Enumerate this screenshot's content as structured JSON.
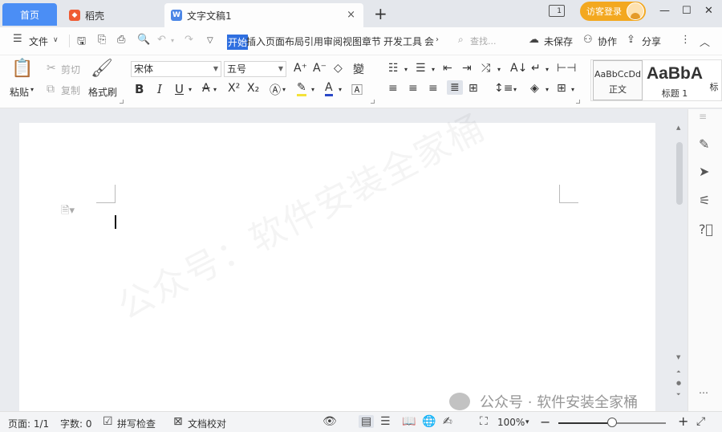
{
  "tabs": {
    "home": "首页",
    "daoke": "稻壳",
    "doc": "文字文稿1",
    "close_glyph": "×",
    "add_glyph": "+"
  },
  "window": {
    "badge": "1",
    "guest_login": "访客登录"
  },
  "menu": {
    "file": "文件",
    "tabs": [
      "开始",
      "插入",
      "页面",
      "布局",
      "引用",
      "审阅",
      "视图",
      "章节",
      "开发工具",
      "会"
    ],
    "search_placeholder": "查找...",
    "unsaved": "未保存",
    "collab": "协作",
    "share": "分享"
  },
  "ribbon": {
    "paste": "粘贴",
    "cut": "剪切",
    "copy": "复制",
    "format_painter": "格式刷",
    "font_name": "宋体",
    "font_size": "五号",
    "styles": [
      {
        "preview": "AaBbCcDd",
        "label": "正文"
      },
      {
        "preview": "AaBbA",
        "label": "标题 1"
      }
    ],
    "style_overflow": "标"
  },
  "document": {
    "watermark": "公众号：软件安装全家桶"
  },
  "status": {
    "page": "页面: 1/1",
    "words": "字数: 0",
    "spellcheck": "拼写检查",
    "proofread": "文档校对",
    "zoom": "100%",
    "zoom_level": 0.5
  },
  "overlay": {
    "wechat_watermark": "公众号 · 软件安装全家桶"
  }
}
